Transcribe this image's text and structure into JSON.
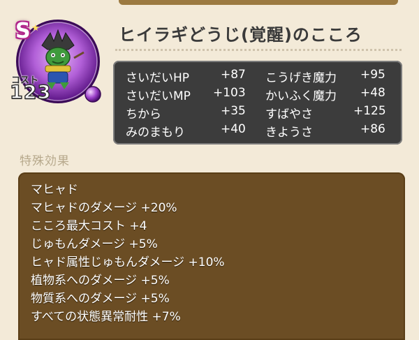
{
  "heart": {
    "rank": "S",
    "cost_label": "コスト",
    "cost_value": "123",
    "title": "ヒイラギどうじ(覚醒)のこころ",
    "colors": {
      "medal": "#8a2fb8",
      "panel": "#3c3c3c",
      "effects_panel": "#6b4d24"
    },
    "icon": "monster-portrait-icon"
  },
  "stats": [
    {
      "label": "さいだいHP",
      "value": "+87"
    },
    {
      "label": "こうげき魔力",
      "value": "+95"
    },
    {
      "label": "さいだいMP",
      "value": "+103"
    },
    {
      "label": "かいふく魔力",
      "value": "+48"
    },
    {
      "label": "ちから",
      "value": "+35"
    },
    {
      "label": "すばやさ",
      "value": "+125"
    },
    {
      "label": "みのまもり",
      "value": "+40"
    },
    {
      "label": "きようさ",
      "value": "+86"
    }
  ],
  "special": {
    "label": "特殊効果",
    "effects": [
      "マヒャド",
      "マヒャドのダメージ +20%",
      "こころ最大コスト +4",
      "じゅもんダメージ +5%",
      "ヒャド属性じゅもんダメージ +10%",
      "植物系へのダメージ +5%",
      "物質系へのダメージ +5%",
      "すべての状態異常耐性 +7%"
    ]
  }
}
